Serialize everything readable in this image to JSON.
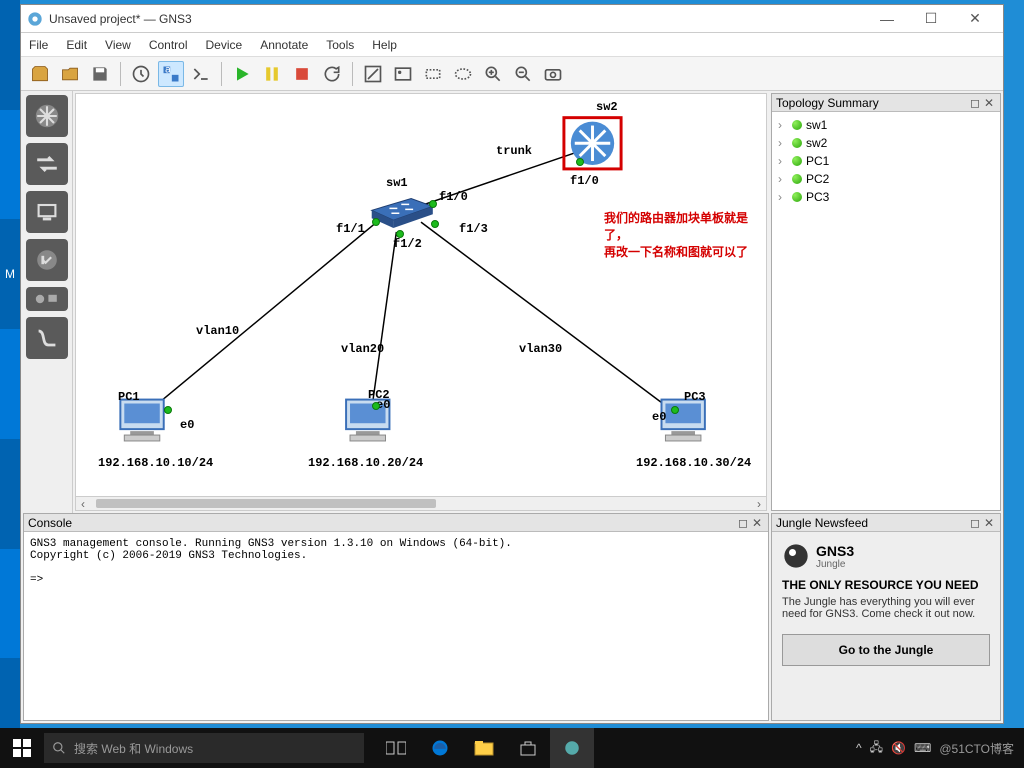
{
  "titlebar": {
    "title": "Unsaved project* — GNS3"
  },
  "menu": [
    "File",
    "Edit",
    "View",
    "Control",
    "Device",
    "Annotate",
    "Tools",
    "Help"
  ],
  "topology_panel": {
    "title": "Topology Summary"
  },
  "topology_items": [
    "sw1",
    "sw2",
    "PC1",
    "PC2",
    "PC3"
  ],
  "console_panel": {
    "title": "Console"
  },
  "console_text": "GNS3 management console. Running GNS3 version 1.3.10 on Windows (64-bit).\nCopyright (c) 2006-2019 GNS3 Technologies.\n\n=>",
  "newsfeed": {
    "title": "Jungle Newsfeed",
    "brand1": "GNS3",
    "brand2": "Jungle",
    "heading": "THE ONLY RESOURCE YOU NEED",
    "body": "The Jungle has everything you will ever need for GNS3. Come check it out now.",
    "button": "Go to the Jungle"
  },
  "canvas": {
    "sw1": "sw1",
    "sw2": "sw2",
    "trunk": "trunk",
    "f10": "f1/0",
    "f11": "f1/1",
    "f12": "f1/2",
    "f13": "f1/3",
    "vlan10": "vlan10",
    "vlan20": "vlan20",
    "vlan30": "vlan30",
    "pc1": "PC1",
    "pc2": "PC2",
    "pc3": "PC3",
    "e0": "e0",
    "ip1": "192.168.10.10/24",
    "ip2": "192.168.10.20/24",
    "ip3": "192.168.10.30/24",
    "annot1": "我们的路由器加块单板就是了，",
    "annot2": "再改一下名称和图就可以了"
  },
  "taskbar": {
    "search": "搜索 Web 和 Windows",
    "watermark": "@51CTO博客"
  },
  "leftletter": "M"
}
